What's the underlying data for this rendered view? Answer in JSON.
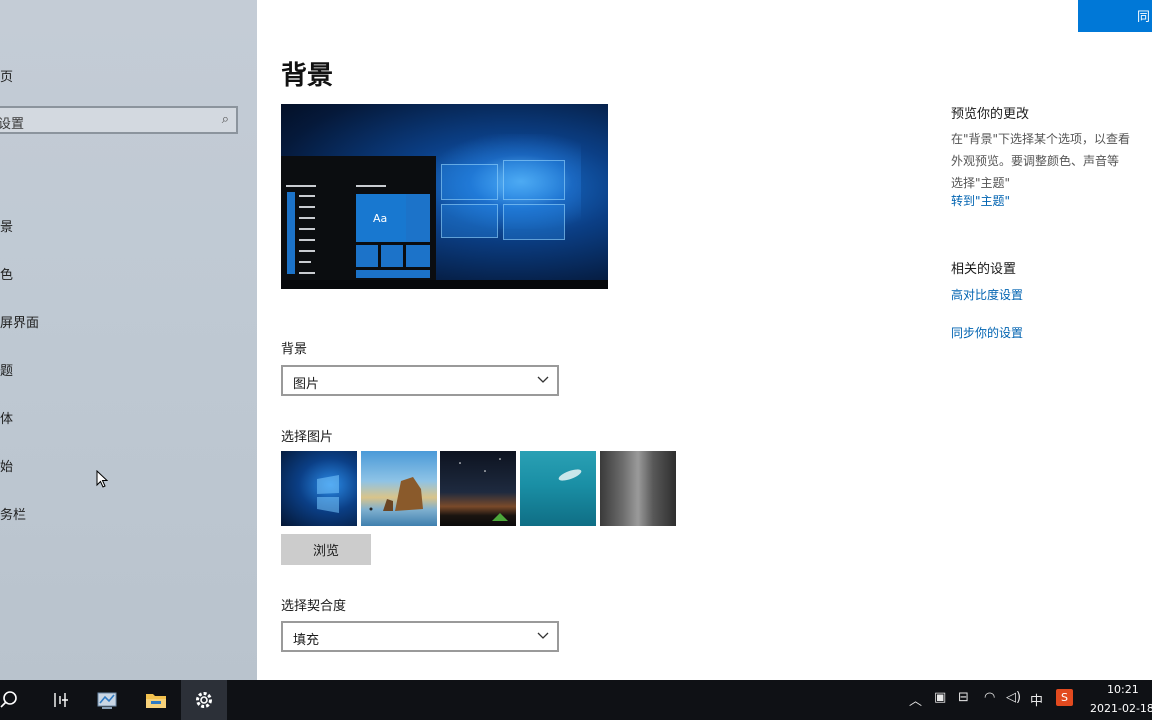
{
  "sidebar": {
    "home": "页",
    "search_placeholder": "设置",
    "items": [
      {
        "label": "景"
      },
      {
        "label": "色"
      },
      {
        "label": "屏界面"
      },
      {
        "label": "题"
      },
      {
        "label": "体"
      },
      {
        "label": "始"
      },
      {
        "label": "务栏"
      }
    ]
  },
  "main": {
    "title": "背景",
    "background_label": "背景",
    "background_value": "图片",
    "choose_picture_label": "选择图片",
    "browse_label": "浏览",
    "fit_label": "选择契合度",
    "fit_value": "填充",
    "preview_tile_text": "Aa"
  },
  "right": {
    "preview_title": "预览你的更改",
    "preview_desc_lines": [
      "在\"背景\"下选择某个选项，以查看",
      "外观预览。要调整颜色、声音等",
      "选择\"主题\""
    ],
    "goto_themes": "转到\"主题\"",
    "related_title": "相关的设置",
    "contrast_link": "高对比度设置",
    "sync_link": "同步你的设置"
  },
  "corner_button": "同",
  "taskbar": {
    "time": "10:21",
    "date": "2021-02-18",
    "ime": "中",
    "icons": [
      "search-icon",
      "task-view-icon",
      "control-panel-icon",
      "file-explorer-icon",
      "settings-icon"
    ]
  },
  "colors": {
    "accent": "#0078d7",
    "link": "#0063b1",
    "sidebar": "#bfc9d3",
    "taskbar": "#0f1115"
  }
}
